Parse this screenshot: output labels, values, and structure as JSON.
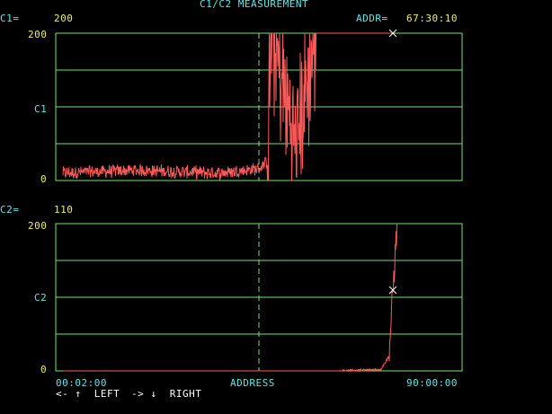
{
  "header": {
    "title": "C1/C2 MEASUREMENT",
    "c1_label": "C1=",
    "c1_value": "200",
    "addr_label": "ADDR=",
    "addr_value": "67:30:10",
    "c2_label": "C2=",
    "c2_value": "110"
  },
  "colors": {
    "grid": "#72e472",
    "trace": "#ff5a5a",
    "cursor_dash": "#72e472",
    "label_cyan": "#5ee6e6",
    "label_yellow": "#f0f05a"
  },
  "plot1": {
    "y_label": "C1",
    "y_ticks": [
      "200",
      "0"
    ],
    "ylim": [
      0,
      200
    ]
  },
  "plot2": {
    "y_label": "C2",
    "y_ticks": [
      "200",
      "0"
    ],
    "ylim": [
      0,
      200
    ]
  },
  "x_axis": {
    "start": "00:02:00",
    "label": "ADDRESS",
    "end": "90:00:00"
  },
  "footer": {
    "left_hint": "<- ↑  LEFT",
    "right_hint": "-> ↓  RIGHT"
  },
  "chart_data": [
    {
      "type": "line",
      "name": "C1",
      "xlabel": "ADDRESS",
      "ylabel": "C1",
      "xlim": [
        "00:02:00",
        "90:00:00"
      ],
      "ylim": [
        0,
        200
      ],
      "grid": true,
      "cursor_value": 200,
      "trace_description_points": [
        {
          "x_frac": 0.0,
          "y": 10
        },
        {
          "x_frac": 0.2,
          "y": 14
        },
        {
          "x_frac": 0.4,
          "y": 10
        },
        {
          "x_frac": 0.5,
          "y": 16
        },
        {
          "x_frac": 0.52,
          "y": 25
        },
        {
          "x_frac": 0.53,
          "y": 200
        },
        {
          "x_frac": 0.59,
          "y": 50
        },
        {
          "x_frac": 0.64,
          "y": 200
        },
        {
          "x_frac": 0.83,
          "y": 200
        }
      ]
    },
    {
      "type": "line",
      "name": "C2",
      "xlabel": "ADDRESS",
      "ylabel": "C2",
      "xlim": [
        "00:02:00",
        "90:00:00"
      ],
      "ylim": [
        0,
        200
      ],
      "grid": true,
      "cursor_value": 110,
      "trace_description_points": [
        {
          "x_frac": 0.0,
          "y": 0
        },
        {
          "x_frac": 0.7,
          "y": 0
        },
        {
          "x_frac": 0.8,
          "y": 2
        },
        {
          "x_frac": 0.82,
          "y": 20
        },
        {
          "x_frac": 0.83,
          "y": 110
        },
        {
          "x_frac": 0.84,
          "y": 200
        }
      ]
    }
  ]
}
